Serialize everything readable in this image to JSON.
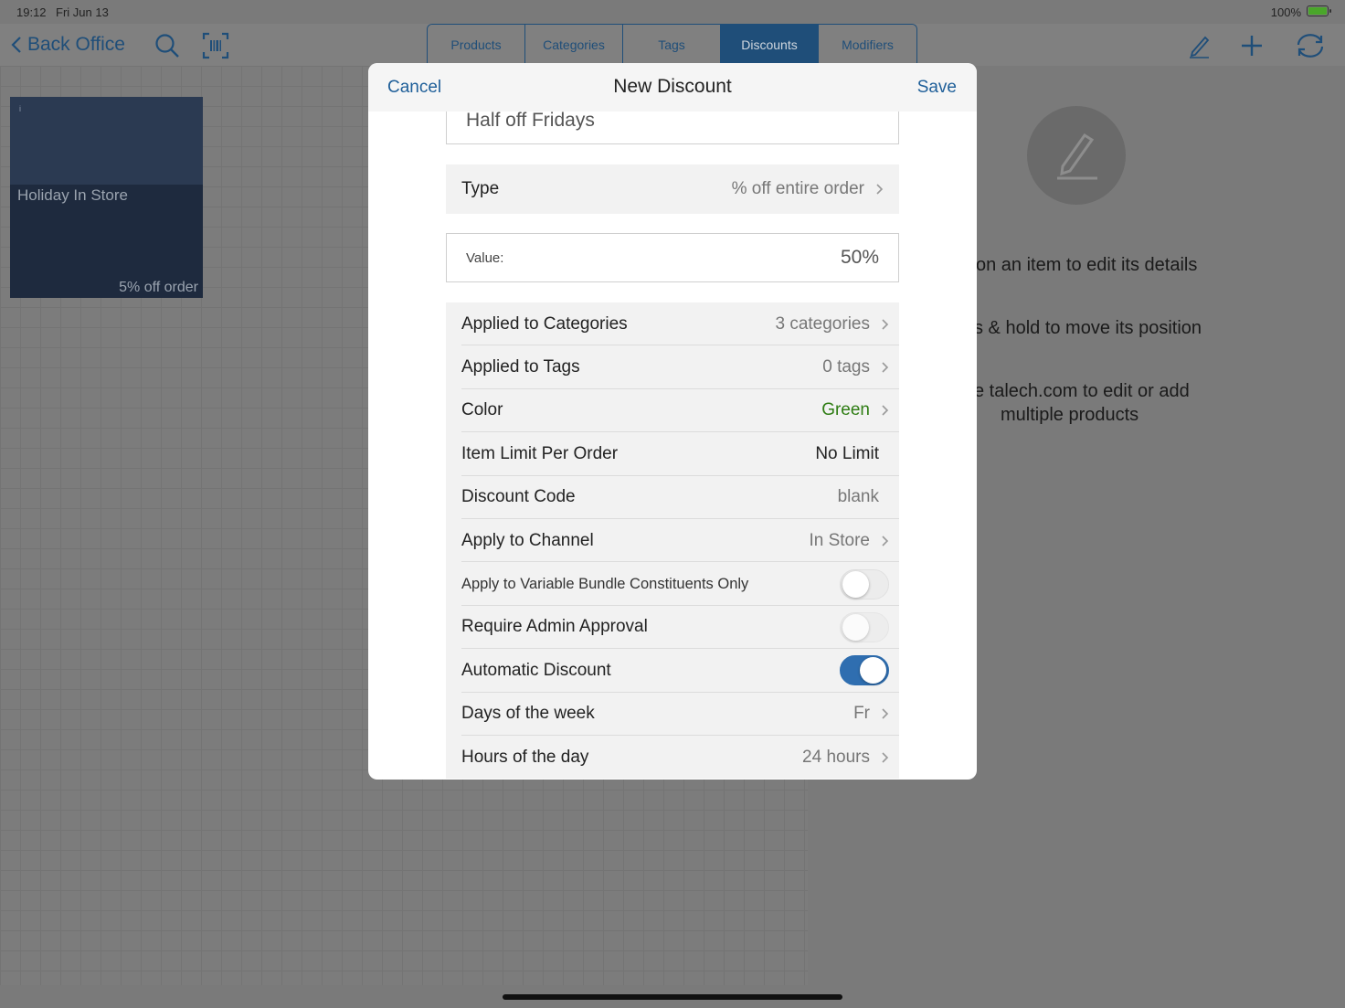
{
  "status": {
    "time": "19:12",
    "date": "Fri Jun 13",
    "battery": "100%"
  },
  "nav": {
    "back_label": "Back Office",
    "tabs": [
      {
        "label": "Products"
      },
      {
        "label": "Categories"
      },
      {
        "label": "Tags"
      },
      {
        "label": "Discounts",
        "active": true
      },
      {
        "label": "Modifiers"
      }
    ]
  },
  "tile": {
    "name": "Holiday In Store",
    "subtitle": "5% off order",
    "info": "i"
  },
  "hints": [
    "on an item to edit its details",
    "s & hold to move its position",
    "e talech.com to edit or add",
    "multiple products"
  ],
  "modal": {
    "cancel": "Cancel",
    "title": "New Discount",
    "save": "Save",
    "name_value": "Half off Fridays",
    "type": {
      "label": "Type",
      "value": "% off entire order"
    },
    "value": {
      "label": "Value:",
      "value": "50%"
    },
    "rows": [
      {
        "label": "Applied to Categories",
        "value": "3 categories"
      },
      {
        "label": "Applied to Tags",
        "value": "0 tags"
      },
      {
        "label": "Color",
        "value": "Green"
      },
      {
        "label": "Item Limit Per Order",
        "value": "No Limit"
      },
      {
        "label": "Discount Code",
        "value": "blank"
      },
      {
        "label": "Apply to Channel",
        "value": "In Store"
      },
      {
        "label": "Apply to Variable Bundle Constituents Only",
        "toggle": false
      },
      {
        "label": "Require Admin Approval",
        "toggle": false
      },
      {
        "label": "Automatic Discount",
        "toggle": true
      },
      {
        "label": "Days of the week",
        "value": "Fr"
      },
      {
        "label": "Hours of the day",
        "value": "24 hours"
      }
    ]
  },
  "colors": {
    "accent": "#1f5f99",
    "tab_active": "#1f4e79",
    "green": "#2f7d14",
    "toggle_on": "#2f6eb0"
  }
}
